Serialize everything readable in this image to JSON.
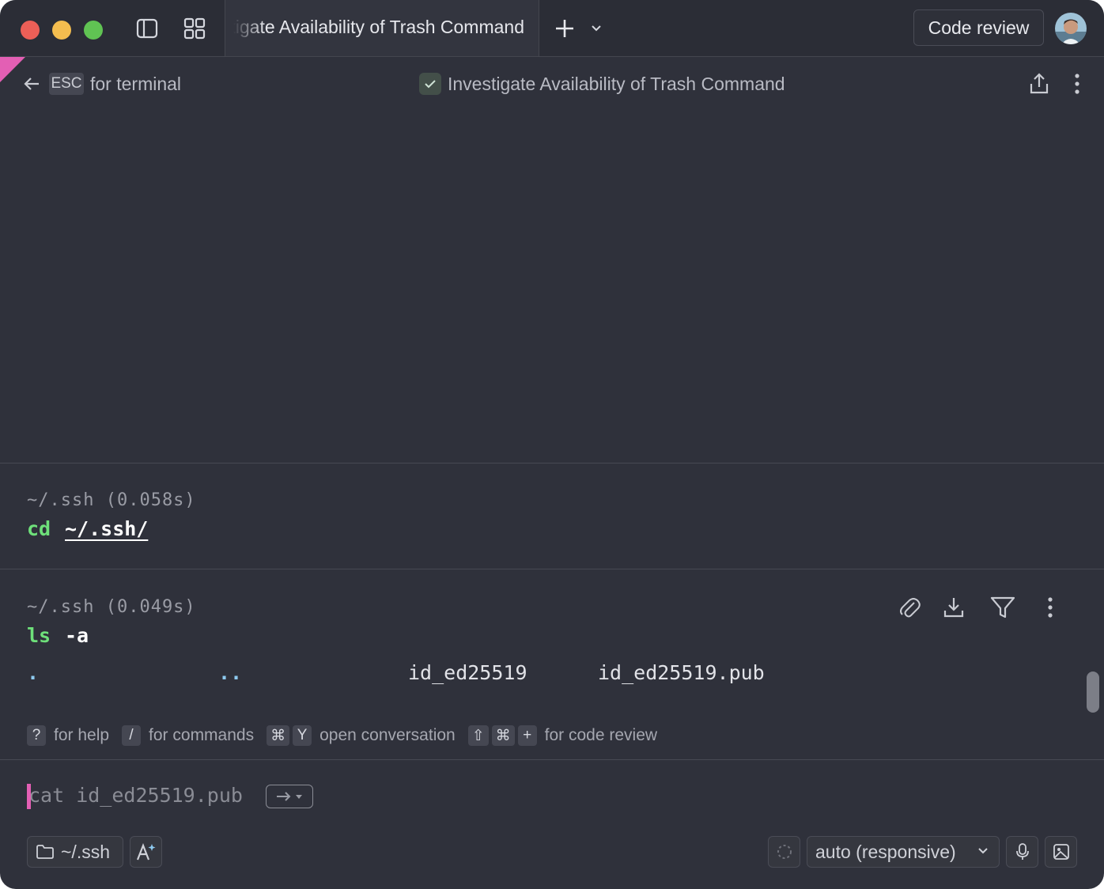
{
  "titlebar": {
    "tab_title": "Investigate Availability of Trash Command",
    "code_review_label": "Code review",
    "new_tab_icon": "plus-icon",
    "tab_menu_icon": "chevron-down-icon",
    "sidebar_icon": "sidebar-toggle-icon",
    "grid_icon": "grid-icon"
  },
  "header": {
    "esc_key": "ESC",
    "esc_hint": "for terminal",
    "conversation_title": "Investigate Availability of Trash Command"
  },
  "blocks": [
    {
      "meta": "~/.ssh (0.058s)",
      "command": "cd",
      "argument": "~/.ssh/"
    },
    {
      "meta": "~/.ssh (0.049s)",
      "command": "ls",
      "argument": "-a",
      "output": [
        ".",
        "..",
        "id_ed25519",
        "id_ed25519.pub"
      ]
    }
  ],
  "hints": {
    "help_key": "?",
    "help_text": "for help",
    "cmd_key": "/",
    "cmd_text": "for commands",
    "conv_key1": "⌘",
    "conv_key2": "Y",
    "conv_text": "open conversation",
    "review_key1": "⇧",
    "review_key2": "⌘",
    "review_key3": "+",
    "review_text": "for code review"
  },
  "input": {
    "suggestion": "cat id_ed25519.pub"
  },
  "footer": {
    "directory": "~/.ssh",
    "model_select": "auto (responsive)"
  },
  "colors": {
    "background": "#2f313b",
    "accent_pink": "#e35fb4",
    "command_green": "#6ee07a",
    "close": "#ec5f57",
    "minimize": "#f4bd4f",
    "maximize": "#60c353"
  }
}
